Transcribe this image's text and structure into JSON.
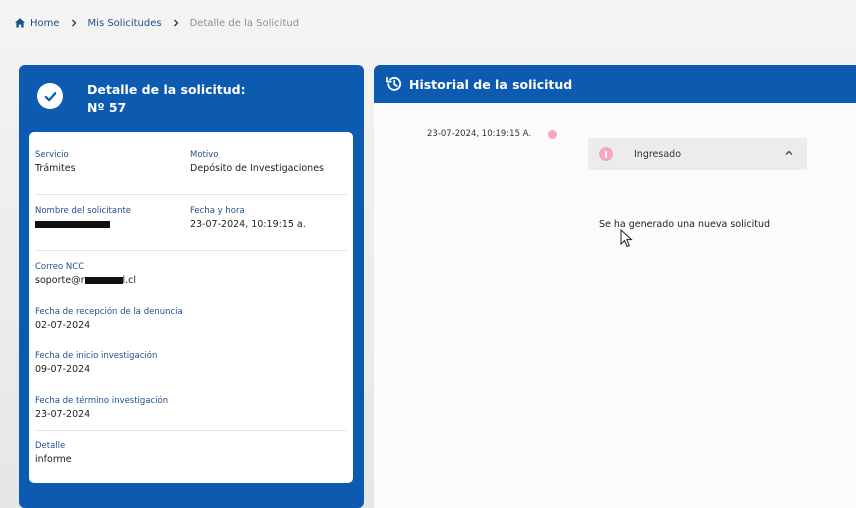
{
  "breadcrumb": {
    "items": [
      "Home",
      "Mis Solicitudes",
      "Detalle de la Solicitud"
    ]
  },
  "detail": {
    "title_line1": "Detalle de la solicitud:",
    "title_line2": "Nº 57",
    "fields": {
      "servicio_label": "Servicio",
      "servicio_value": "Trámites",
      "motivo_label": "Motivo",
      "motivo_value": "Depósito de Investigaciones",
      "solicitante_label": "Nombre del solicitante",
      "fecha_hora_label": "Fecha y hora",
      "fecha_hora_value": "23-07-2024, 10:19:15 a.",
      "correo_label": "Correo NCC",
      "correo_prefix": "soporte@r",
      "correo_suffix": "l.cl",
      "recepcion_label": "Fecha de recepción de la denuncia",
      "recepcion_value": "02-07-2024",
      "inicio_label": "Fecha de inicio investigación",
      "inicio_value": "09-07-2024",
      "termino_label": "Fecha de término investigación",
      "termino_value": "23-07-2024",
      "detalle_label": "Detalle",
      "detalle_value": "informe"
    }
  },
  "history": {
    "title": "Historial de la solicitud",
    "entries": [
      {
        "date": "23-07-2024, 10:19:15 A.",
        "status": "Ingresado",
        "description": "Se ha generado una nueva solicitud"
      }
    ]
  },
  "colors": {
    "primary": "#0d5bb0",
    "status_dot": "#f4a7bd",
    "label": "#1f4e8c"
  }
}
